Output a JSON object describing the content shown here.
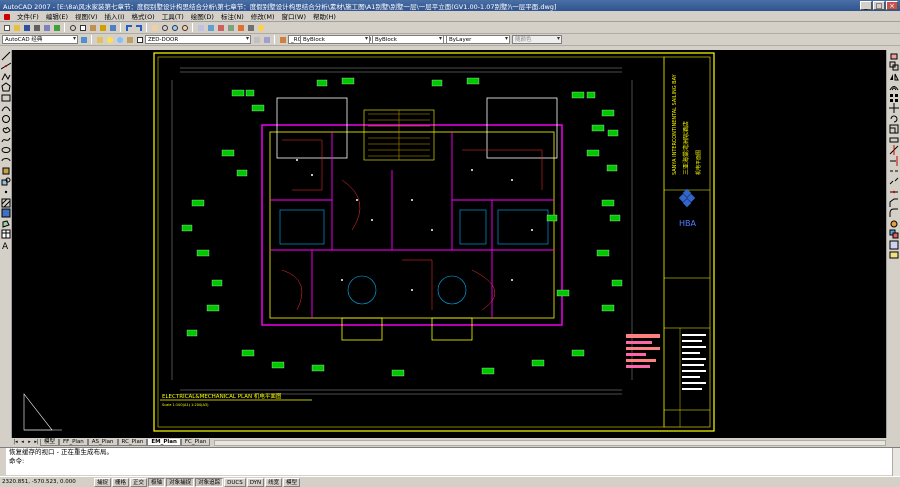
{
  "window": {
    "title": "AutoCAD 2007 - [E:\\8a\\风水家装第七章节：度假别墅设计构思结合分析\\第七章节：度假别墅设计构思结合分析\\素材\\施工图\\A1别墅\\别墅一层\\一层平立面(GV1.00-1.07别墅)\\一层平面.dwg]",
    "minimize_label": "_",
    "maximize_label": "□",
    "close_label": "×"
  },
  "menu": {
    "items": [
      "文件(F)",
      "编辑(E)",
      "视图(V)",
      "插入(I)",
      "格式(O)",
      "工具(T)",
      "绘图(D)",
      "标注(N)",
      "修改(M)",
      "窗口(W)",
      "帮助(H)"
    ]
  },
  "toolbar2": {
    "workspace": "AutoCAD 经典",
    "layer": "ZED-DOOR",
    "text_style": "_ROTXT",
    "dim_style": "HBA_50",
    "table_style": "Standard"
  },
  "toolbar3": {
    "color": "ByBlock",
    "linetype": "ByBlock",
    "lineweight": "ByLayer",
    "plot_style": "随颜色"
  },
  "drawing": {
    "sheet_title": "ELECTRICAL&MECHANICAL PLAN  机电平面图",
    "scale_note": "Scale 1:100(A1) 1:200(A3)",
    "project_name_en": "SANYA INTERCONTINENTAL SAILING BAY",
    "project_name_cn": "三亚海棠湾洲际酒店",
    "logo_text": "HBA",
    "note_label": "机电平面图"
  },
  "layout_tabs": {
    "tabs": [
      "模型",
      "FF_Plan",
      "AS_Plan",
      "RC_Plan",
      "EM_Plan",
      "FC_Plan"
    ],
    "active_index": 4
  },
  "command": {
    "line1": "恢复缓存的视口 - 正在重生成布局。",
    "prompt": "命令:",
    "input_value": ""
  },
  "status": {
    "coords": "2320.851, -570.523, 0.000",
    "toggles": [
      {
        "label": "捕捉",
        "on": false
      },
      {
        "label": "栅格",
        "on": false
      },
      {
        "label": "正交",
        "on": false
      },
      {
        "label": "极轴",
        "on": true
      },
      {
        "label": "对象捕捉",
        "on": true
      },
      {
        "label": "对象追踪",
        "on": true
      },
      {
        "label": "DUCS",
        "on": false
      },
      {
        "label": "DYN",
        "on": false
      },
      {
        "label": "线宽",
        "on": false
      },
      {
        "label": "模型",
        "on": false
      }
    ]
  },
  "colors": {
    "title_bar": "#2f5490",
    "canvas_bg": "#000000",
    "frame_yellow": "#ffff00",
    "tag_green": "#00c800",
    "wall_magenta": "#ff00ff",
    "logo_blue": "#3366cc"
  }
}
